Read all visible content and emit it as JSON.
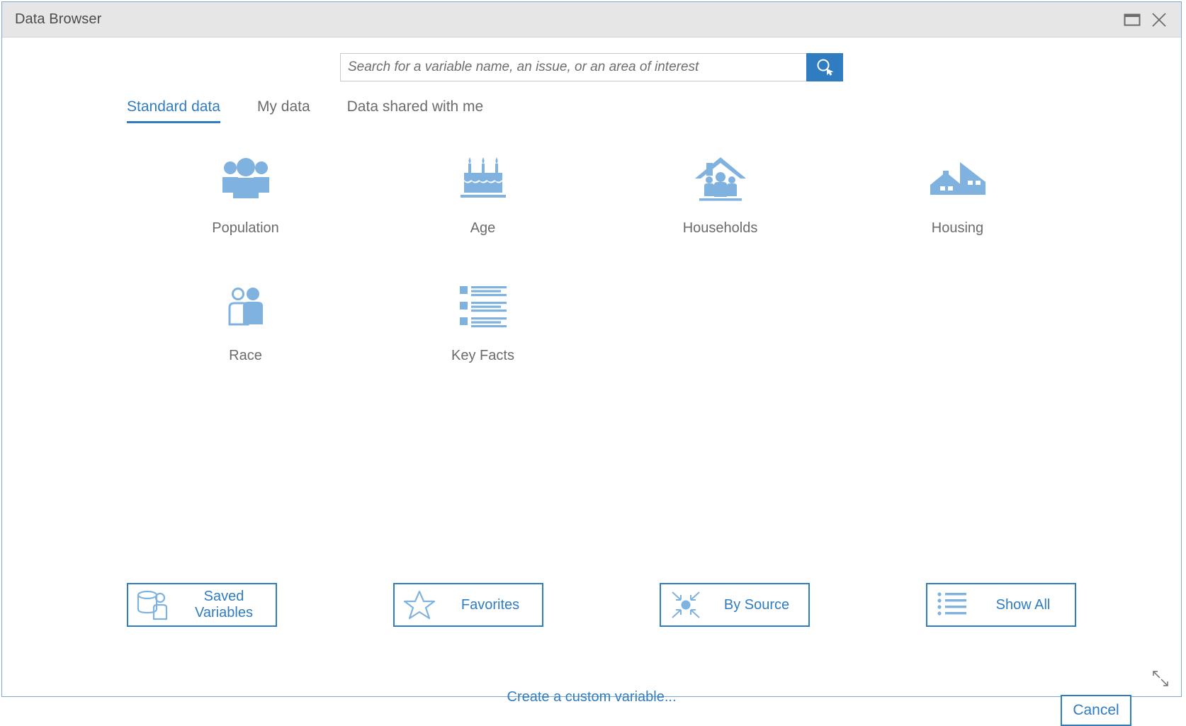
{
  "window": {
    "title": "Data Browser",
    "controls": [
      {
        "name": "restore-window-button",
        "icon": "restore-icon"
      },
      {
        "name": "close-window-button",
        "icon": "close-icon"
      }
    ]
  },
  "search": {
    "placeholder": "Search for a variable name, an issue, or an area of interest",
    "value": "",
    "button_icon": "search-icon"
  },
  "tabs": [
    {
      "label": "Standard data",
      "active": true
    },
    {
      "label": "My data",
      "active": false
    },
    {
      "label": "Data shared with me",
      "active": false
    }
  ],
  "categories": [
    {
      "label": "Population",
      "icon": "people-group-icon"
    },
    {
      "label": "Age",
      "icon": "birthday-cake-icon"
    },
    {
      "label": "Households",
      "icon": "house-with-people-icon"
    },
    {
      "label": "Housing",
      "icon": "houses-icon"
    },
    {
      "label": "Race",
      "icon": "two-people-icon"
    },
    {
      "label": "Key Facts",
      "icon": "list-facts-icon"
    }
  ],
  "actions": [
    {
      "label": "Saved Variables",
      "icon": "database-person-icon"
    },
    {
      "label": "Favorites",
      "icon": "star-icon"
    },
    {
      "label": "By Source",
      "icon": "converging-arrows-icon"
    },
    {
      "label": "Show All",
      "icon": "bullet-list-icon"
    }
  ],
  "footer": {
    "custom_variable_link": "Create a custom variable...",
    "cancel_label": "Cancel"
  },
  "colors": {
    "accent": "#2f7cc1",
    "icon_blue": "#7fb2de",
    "title_bar": "#e6e6e6",
    "text_gray": "#6b6b6b"
  }
}
